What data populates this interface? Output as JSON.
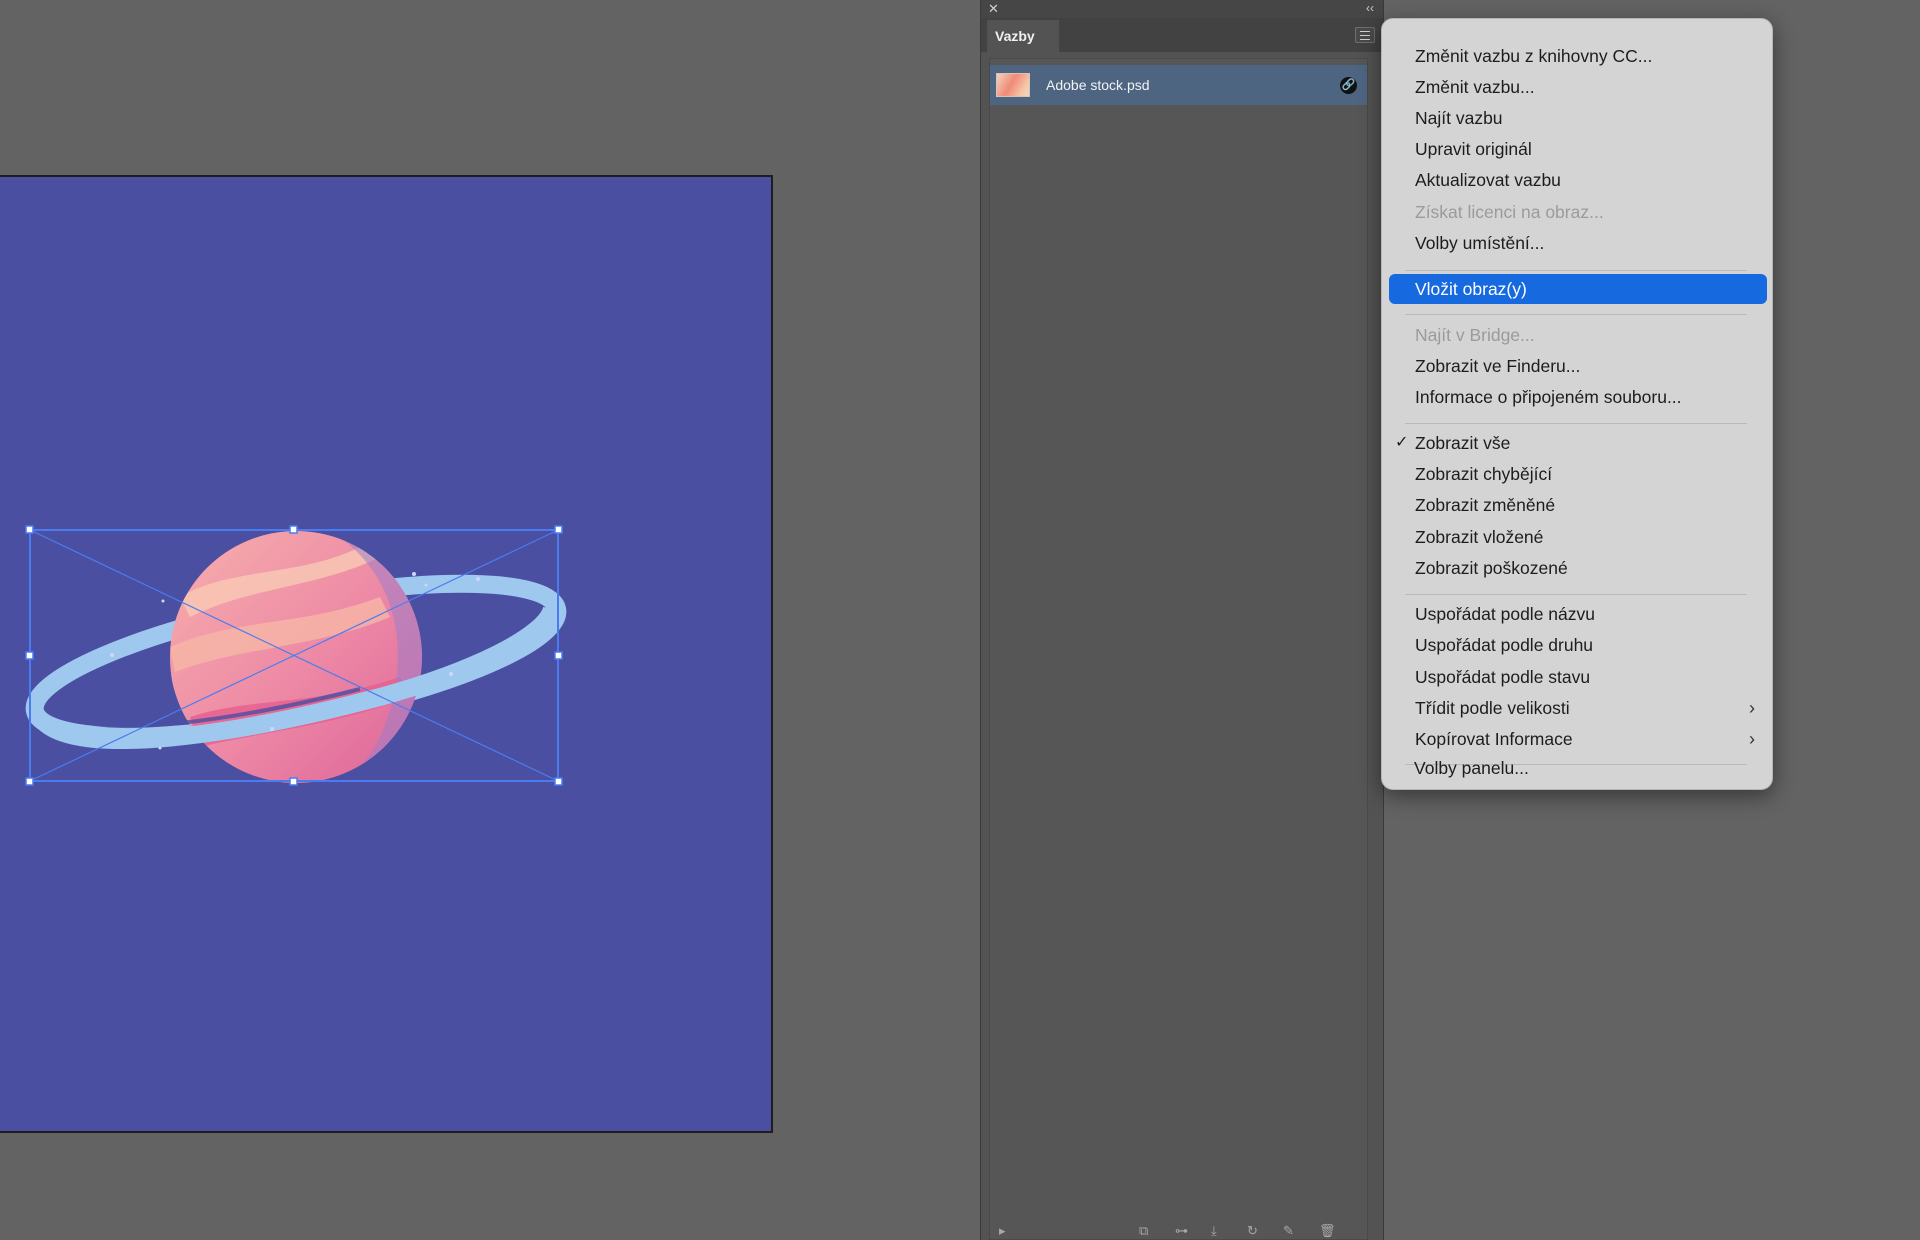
{
  "links_panel": {
    "tab_label": "Vazby",
    "close_glyph": "✕",
    "collapse_glyph": "‹‹",
    "link_item": {
      "file_name": "Adobe stock.psd",
      "status_icon": "link-icon"
    }
  },
  "context_menu": {
    "items": [
      {
        "label": "Změnit vazbu z knihovny CC...",
        "enabled": true
      },
      {
        "label": "Změnit vazbu...",
        "enabled": true
      },
      {
        "label": "Najít vazbu",
        "enabled": true
      },
      {
        "label": "Upravit originál",
        "enabled": true
      },
      {
        "label": "Aktualizovat vazbu",
        "enabled": true
      },
      {
        "label": "Získat licenci na obraz...",
        "enabled": false
      },
      {
        "label": "Volby umístění...",
        "enabled": true
      },
      {
        "label": "Vložit obraz(y)",
        "enabled": true,
        "highlighted": true
      },
      {
        "label": "Najít v Bridge...",
        "enabled": false
      },
      {
        "label": "Zobrazit ve Finderu...",
        "enabled": true
      },
      {
        "label": "Informace o připojeném souboru...",
        "enabled": true
      },
      {
        "label": "Zobrazit vše",
        "enabled": true,
        "checked": true
      },
      {
        "label": "Zobrazit chybějící",
        "enabled": true
      },
      {
        "label": "Zobrazit změněné",
        "enabled": true
      },
      {
        "label": "Zobrazit vložené",
        "enabled": true
      },
      {
        "label": "Zobrazit poškozené",
        "enabled": true
      },
      {
        "label": "Uspořádat podle názvu",
        "enabled": true
      },
      {
        "label": "Uspořádat podle druhu",
        "enabled": true
      },
      {
        "label": "Uspořádat podle stavu",
        "enabled": true
      },
      {
        "label": "Třídit podle velikosti",
        "enabled": true,
        "submenu": true
      },
      {
        "label": "Kopírovat Informace",
        "enabled": true,
        "submenu": true
      },
      {
        "label": "Volby panelu...",
        "enabled": true
      }
    ],
    "check_glyph": "✓",
    "submenu_glyph": "›"
  },
  "colors": {
    "canvas_bg": "#636363",
    "artboard_fill": "#4a4fa2",
    "selection_color": "#4a7cf0",
    "menu_highlight": "#1769e0",
    "panel_bg": "#535353"
  }
}
